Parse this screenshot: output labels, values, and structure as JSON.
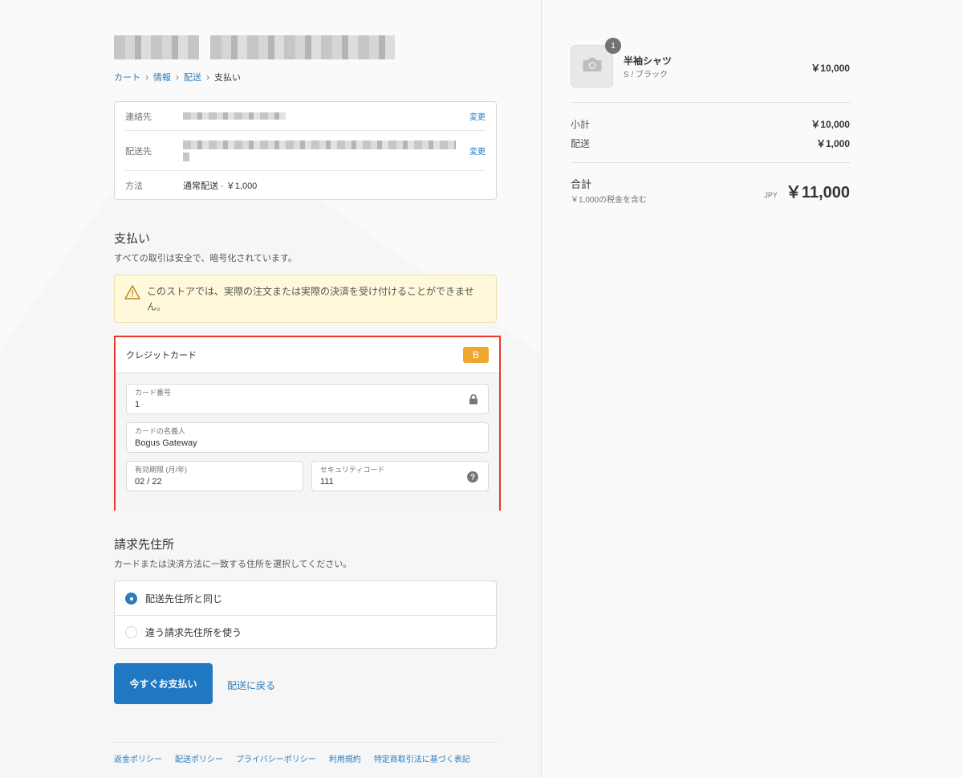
{
  "breadcrumb": {
    "cart": "カート",
    "info": "情報",
    "shipping": "配送",
    "payment": "支払い"
  },
  "review": {
    "contact_label": "連絡先",
    "shipto_label": "配送先",
    "method_label": "方法",
    "method_value": "通常配送 · ￥1,000",
    "change_label": "変更"
  },
  "payment": {
    "heading": "支払い",
    "subtitle": "すべての取引は安全で、暗号化されています。",
    "notice": "このストアでは、実際の注文または実際の決済を受け付けることができません。",
    "card_title": "クレジットカード",
    "card_badge": "B",
    "fields": {
      "number_label": "カード番号",
      "number_value": "1",
      "name_label": "カードの名義人",
      "name_value": "Bogus Gateway",
      "expiry_label": "有効期限 (月/年)",
      "expiry_value": "02 / 22",
      "cvv_label": "セキュリティコード",
      "cvv_value": "111"
    }
  },
  "billing": {
    "heading": "請求先住所",
    "subtitle": "カードまたは決済方法に一致する住所を選択してください。",
    "options": [
      {
        "label": "配送先住所と同じ",
        "selected": true
      },
      {
        "label": "違う請求先住所を使う",
        "selected": false
      }
    ]
  },
  "actions": {
    "pay_now": "今すぐお支払い",
    "back": "配送に戻る"
  },
  "footer": {
    "links": [
      "返金ポリシー",
      "配送ポリシー",
      "プライバシーポリシー",
      "利用規約",
      "特定商取引法に基づく表記"
    ]
  },
  "summary": {
    "product": {
      "name": "半袖シャツ",
      "variant": "S / ブラック",
      "price": "￥10,000",
      "quantity": "1",
      "thumb_icon": "camera-icon"
    },
    "subtotal_label": "小計",
    "subtotal_value": "￥10,000",
    "shipping_label": "配送",
    "shipping_value": "￥1,000",
    "total_label": "合計",
    "tax_note": "￥1,000の税金を含む",
    "currency": "JPY",
    "total_value": "￥11,000"
  },
  "colors": {
    "accent": "#1f78c1",
    "highlight_border": "#e8382b",
    "badge": "#f0a52c",
    "notice_bg": "#fff8db"
  }
}
